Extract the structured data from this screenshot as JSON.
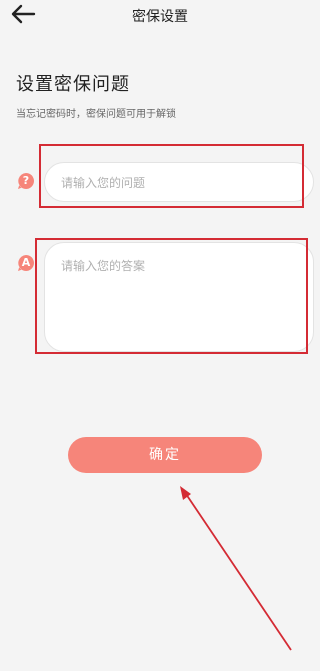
{
  "header": {
    "title": "密保设置",
    "back_icon": "arrow-left-icon"
  },
  "section": {
    "title": "设置密保问题",
    "subtitle": "当忘记密码时，密保问题可用于解锁"
  },
  "question": {
    "badge": "?",
    "placeholder": "请输入您的问题",
    "icon": "question-badge-icon"
  },
  "answer": {
    "badge": "A",
    "placeholder": "请输入您的答案",
    "icon": "answer-badge-icon"
  },
  "confirm": {
    "label": "确定"
  },
  "colors": {
    "accent": "#f6857a",
    "annotation": "#d42b34",
    "background": "#f4f4f4"
  }
}
